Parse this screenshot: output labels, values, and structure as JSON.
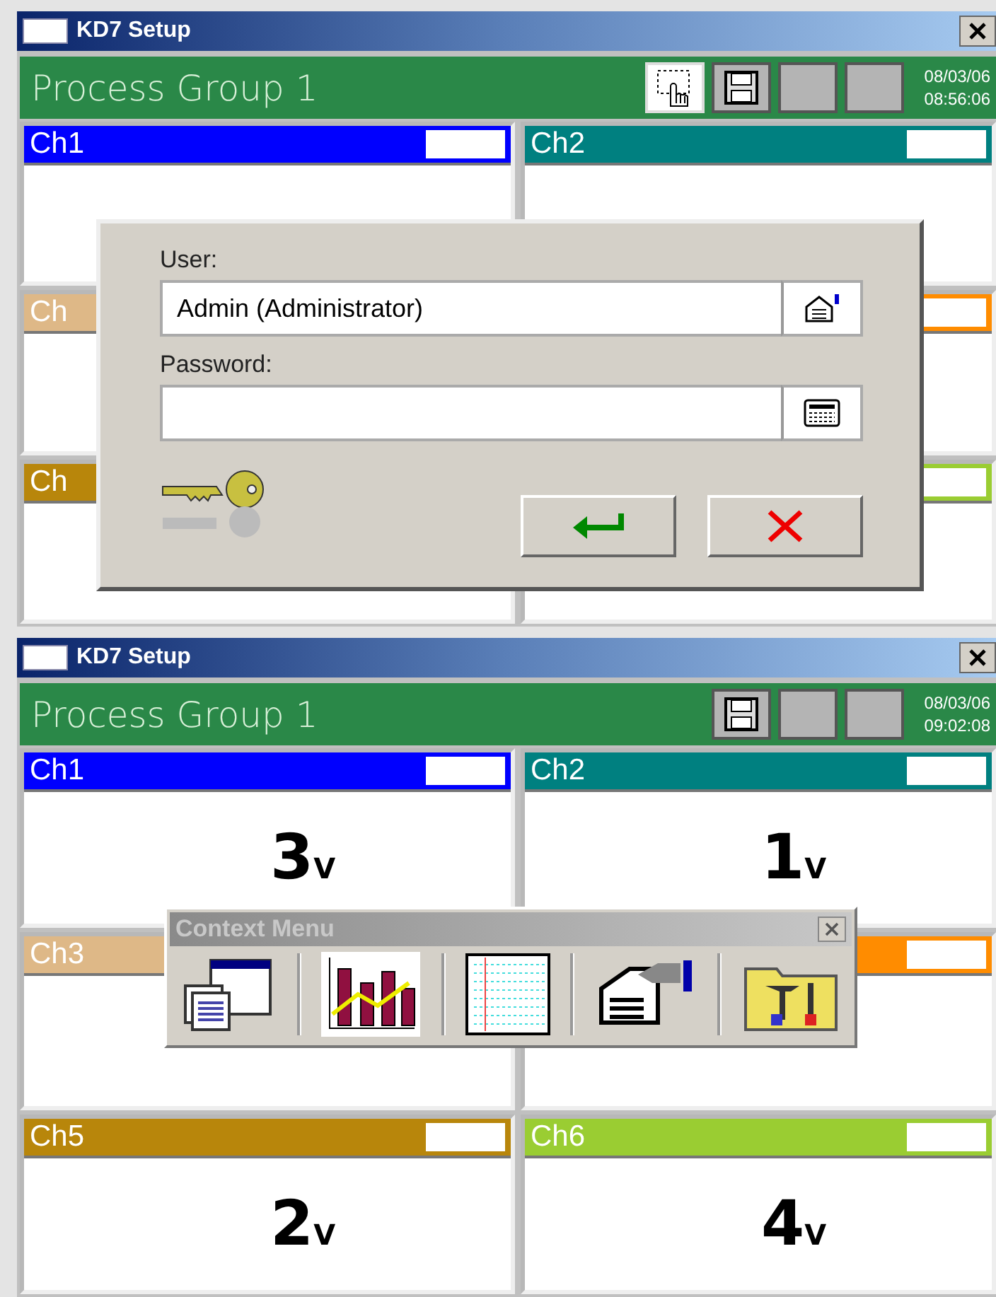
{
  "screens": [
    {
      "window": {
        "title": "KD7 Setup"
      },
      "group": {
        "title": "Process Group 1",
        "date": "08/03/06",
        "time": "08:56:06"
      },
      "toolbar": [
        {
          "kind": "touch"
        },
        {
          "kind": "save"
        },
        {
          "kind": "blank"
        },
        {
          "kind": "blank"
        }
      ],
      "channels": [
        {
          "label": "Ch1",
          "color": "#0000ff"
        },
        {
          "label": "Ch2",
          "color": "#008080"
        },
        {
          "label": "Ch",
          "color": "#deb887"
        },
        {
          "color": "#ff8c00"
        },
        {
          "label": "Ch",
          "color": "#b8860b"
        },
        {
          "color": "#9acd32"
        }
      ],
      "overlay": {
        "kind": "login",
        "user_label": "User:",
        "user_value": "Admin (Administrator)",
        "password_label": "Password:"
      }
    },
    {
      "window": {
        "title": "KD7 Setup"
      },
      "group": {
        "title": "Process Group 1",
        "date": "08/03/06",
        "time": "09:02:08"
      },
      "toolbar": [
        {
          "kind": "save"
        },
        {
          "kind": "blank"
        },
        {
          "kind": "blank"
        }
      ],
      "channels": [
        {
          "label": "Ch1",
          "color": "#0000ff",
          "value": "3",
          "unit": "V"
        },
        {
          "label": "Ch2",
          "color": "#008080",
          "value": "1",
          "unit": "V"
        },
        {
          "label": "Ch3",
          "color": "#deb887"
        },
        {
          "color": "#ff8c00"
        },
        {
          "label": "Ch5",
          "color": "#b8860b",
          "value": "2",
          "unit": "V"
        },
        {
          "label": "Ch6",
          "color": "#9acd32",
          "value": "4",
          "unit": "V"
        }
      ],
      "overlay": {
        "kind": "context_menu",
        "title": "Context Menu",
        "items": [
          {
            "kind": "windows"
          },
          {
            "kind": "chart"
          },
          {
            "kind": "grid"
          },
          {
            "kind": "settings"
          },
          {
            "kind": "tools"
          }
        ]
      }
    }
  ]
}
